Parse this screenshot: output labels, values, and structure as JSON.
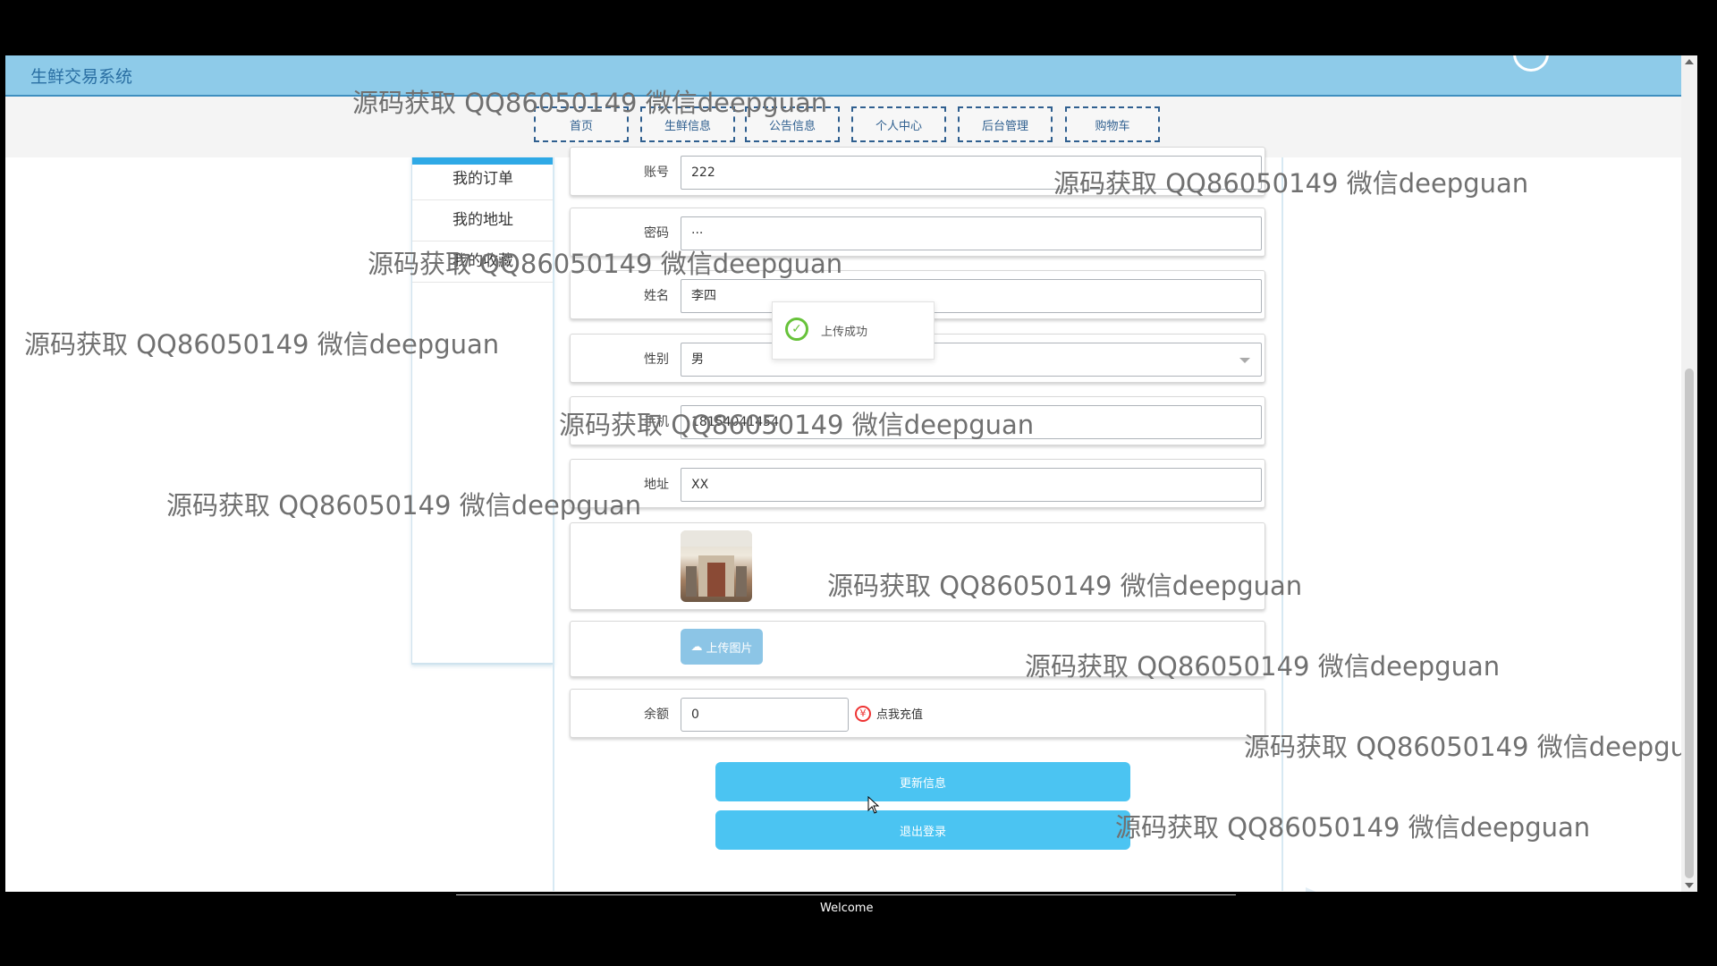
{
  "app": {
    "title": "生鲜交易系统"
  },
  "nav": {
    "items": [
      "首页",
      "生鲜信息",
      "公告信息",
      "个人中心",
      "后台管理",
      "购物车"
    ]
  },
  "sidebar": {
    "items": [
      "我的订单",
      "我的地址",
      "我的收藏"
    ]
  },
  "form": {
    "account": {
      "label": "账号",
      "value": "222"
    },
    "password": {
      "label": "密码",
      "value": "···"
    },
    "name": {
      "label": "姓名",
      "value": "李四"
    },
    "gender": {
      "label": "性别",
      "value": "男"
    },
    "phone": {
      "label": "手机",
      "value": "18154041454"
    },
    "address": {
      "label": "地址",
      "value": "XX"
    },
    "upload_label": "上传图片",
    "balance": {
      "label": "余额",
      "value": "0"
    },
    "recharge_label": "点我充值",
    "update_button": "更新信息",
    "logout_button": "退出登录"
  },
  "toast": {
    "message": "上传成功"
  },
  "watermark": "源码获取 QQ86050149 微信deepguan",
  "footer": {
    "welcome": "Welcome"
  },
  "colors": {
    "topbar": "#8ecbe9",
    "button": "#4bc4f2",
    "accent": "#2fa9e6",
    "success": "#67c23a"
  }
}
